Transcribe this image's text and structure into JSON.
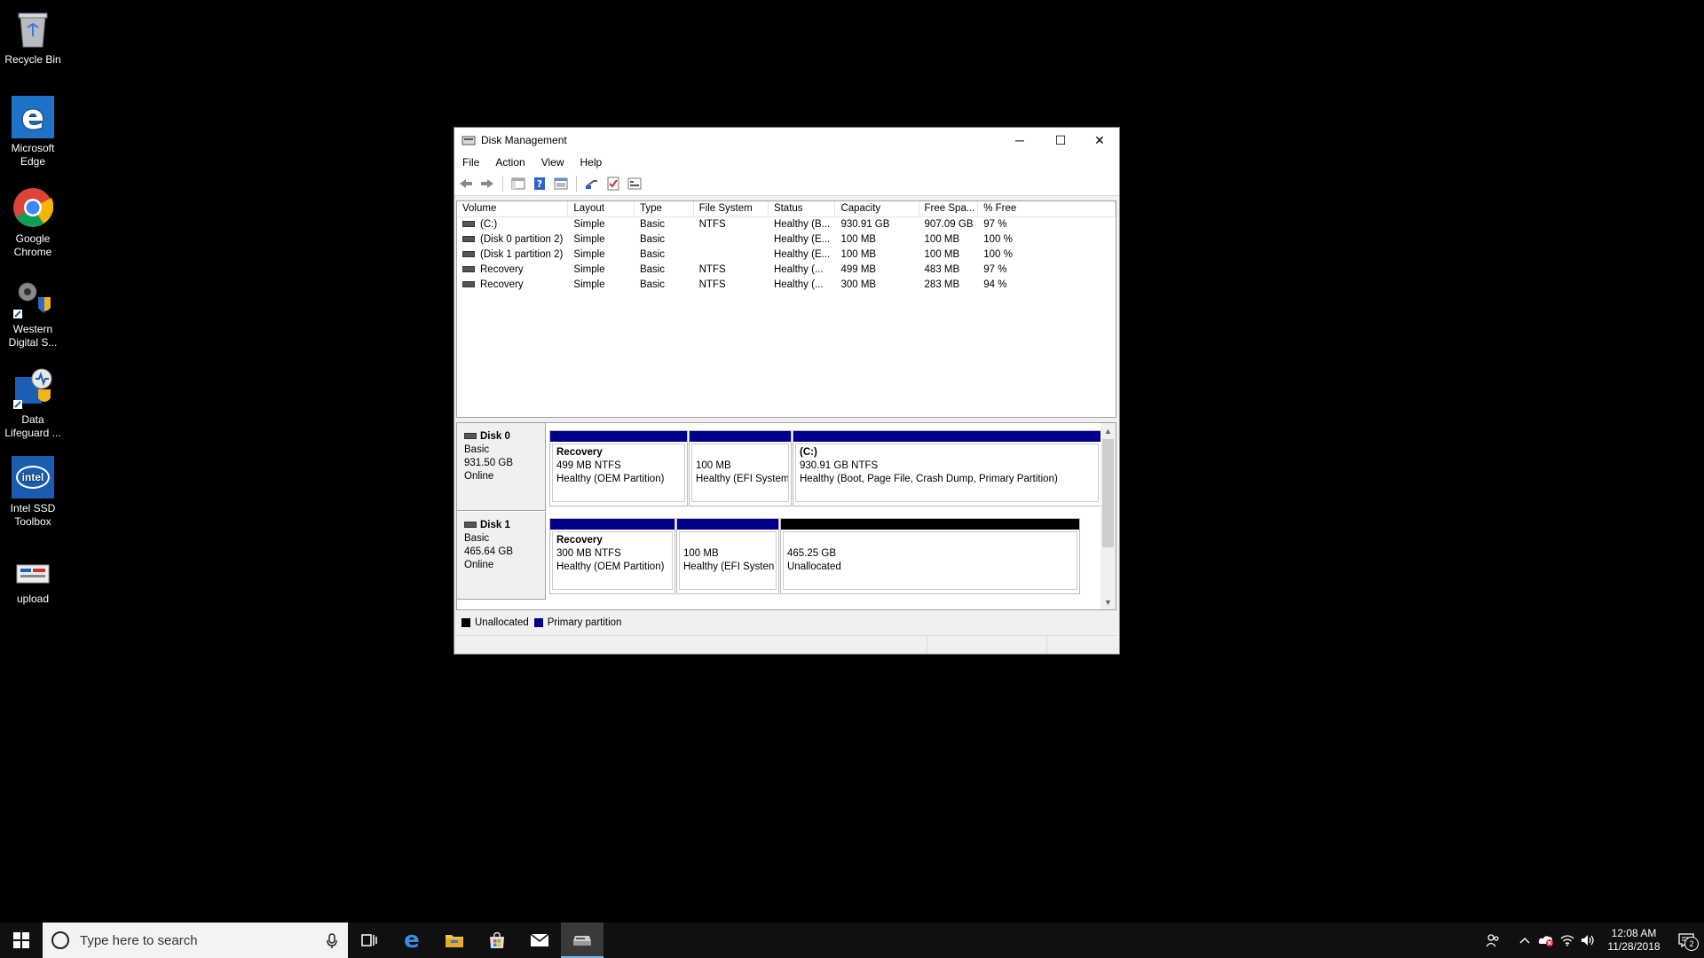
{
  "desktop": {
    "icons": [
      {
        "label": "Recycle Bin",
        "icon": "recycle-bin-icon"
      },
      {
        "label": "Microsoft Edge",
        "icon": "edge-icon"
      },
      {
        "label": "Google Chrome",
        "icon": "chrome-icon"
      },
      {
        "label": "Western Digital S...",
        "icon": "western-digital-icon"
      },
      {
        "label": "Data Lifeguard ...",
        "icon": "data-lifeguard-icon"
      },
      {
        "label": "Intel SSD Toolbox",
        "icon": "intel-icon"
      },
      {
        "label": "upload",
        "icon": "upload-icon"
      }
    ]
  },
  "window": {
    "title": "Disk Management",
    "controls": {
      "minimize": "─",
      "maximize": "☐",
      "close": "✕"
    },
    "menu": [
      "File",
      "Action",
      "View",
      "Help"
    ],
    "toolbar": [
      "back-icon",
      "forward-icon",
      "console-tree-icon",
      "help-icon",
      "properties-icon",
      "connect-icon",
      "check-icon",
      "settings-icon"
    ]
  },
  "volumes": {
    "columns": [
      "Volume",
      "Layout",
      "Type",
      "File System",
      "Status",
      "Capacity",
      "Free Spa...",
      "% Free"
    ],
    "rows": [
      [
        "(C:)",
        "Simple",
        "Basic",
        "NTFS",
        "Healthy (B...",
        "930.91 GB",
        "907.09 GB",
        "97 %"
      ],
      [
        "(Disk 0 partition 2)",
        "Simple",
        "Basic",
        "",
        "Healthy (E...",
        "100 MB",
        "100 MB",
        "100 %"
      ],
      [
        "(Disk 1 partition 2)",
        "Simple",
        "Basic",
        "",
        "Healthy (E...",
        "100 MB",
        "100 MB",
        "100 %"
      ],
      [
        "Recovery",
        "Simple",
        "Basic",
        "NTFS",
        "Healthy (...",
        "499 MB",
        "483 MB",
        "97 %"
      ],
      [
        "Recovery",
        "Simple",
        "Basic",
        "NTFS",
        "Healthy (...",
        "300 MB",
        "283 MB",
        "94 %"
      ]
    ]
  },
  "disks": [
    {
      "name": "Disk 0",
      "type": "Basic",
      "size": "931.50 GB",
      "state": "Online",
      "partitions": [
        {
          "title": "Recovery",
          "line1": "499 MB NTFS",
          "line2": "Healthy (OEM Partition)",
          "kind": "primary"
        },
        {
          "title": "",
          "line1": "100 MB",
          "line2": "Healthy (EFI System",
          "kind": "primary"
        },
        {
          "title": "(C:)",
          "line1": "930.91 GB NTFS",
          "line2": "Healthy (Boot, Page File, Crash Dump, Primary Partition)",
          "kind": "primary"
        }
      ]
    },
    {
      "name": "Disk 1",
      "type": "Basic",
      "size": "465.64 GB",
      "state": "Online",
      "partitions": [
        {
          "title": "Recovery",
          "line1": "300 MB NTFS",
          "line2": "Healthy (OEM Partition)",
          "kind": "primary"
        },
        {
          "title": "",
          "line1": "100 MB",
          "line2": "Healthy (EFI Systen",
          "kind": "primary"
        },
        {
          "title": "",
          "line1": "465.25 GB",
          "line2": "Unallocated",
          "kind": "unallocated"
        }
      ]
    }
  ],
  "legend": [
    {
      "label": "Unallocated",
      "color": "#000000"
    },
    {
      "label": "Primary partition",
      "color": "#00008b"
    }
  ],
  "taskbar": {
    "search_placeholder": "Type here to search",
    "time": "12:08 AM",
    "date": "11/28/2018",
    "notification_count": "2"
  },
  "colors": {
    "primary_partition": "#00008b",
    "unallocated": "#000000",
    "desktop": "#000000"
  }
}
